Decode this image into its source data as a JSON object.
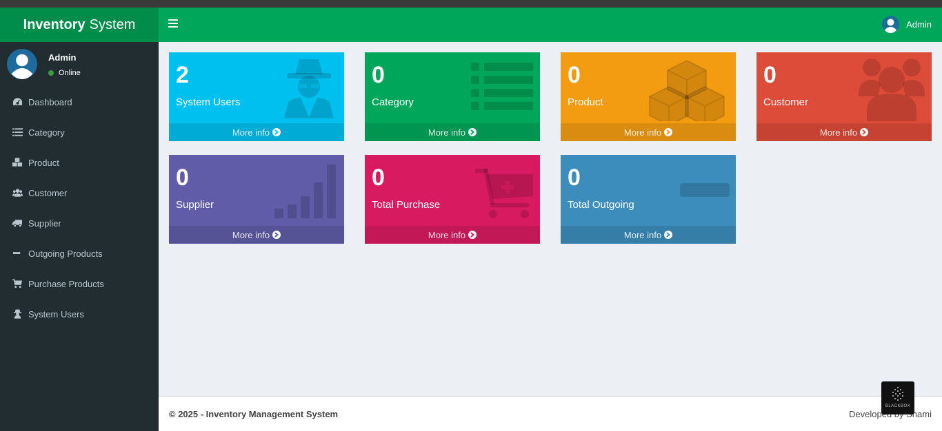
{
  "app": {
    "logo_bold": "Inventory",
    "logo_light": "System"
  },
  "header": {
    "user_name": "Admin"
  },
  "sidebar": {
    "user": {
      "name": "Admin",
      "status": "Online"
    },
    "items": [
      {
        "label": "Dashboard",
        "icon": "dashboard-icon"
      },
      {
        "label": "Category",
        "icon": "list-icon"
      },
      {
        "label": "Product",
        "icon": "cubes-icon"
      },
      {
        "label": "Customer",
        "icon": "users-icon"
      },
      {
        "label": "Supplier",
        "icon": "truck-icon"
      },
      {
        "label": "Outgoing Products",
        "icon": "minus-icon"
      },
      {
        "label": "Purchase Products",
        "icon": "cart-icon"
      },
      {
        "label": "System Users",
        "icon": "user-secret-icon"
      }
    ]
  },
  "boxes": [
    {
      "value": "2",
      "label": "System Users",
      "more": "More info",
      "color": "#00c0ef",
      "icon": "user-secret-icon"
    },
    {
      "value": "0",
      "label": "Category",
      "more": "More info",
      "color": "#00a65a",
      "icon": "list-icon"
    },
    {
      "value": "0",
      "label": "Product",
      "more": "More info",
      "color": "#f39c12",
      "icon": "cubes-icon"
    },
    {
      "value": "0",
      "label": "Customer",
      "more": "More info",
      "color": "#dd4b39",
      "icon": "users-icon"
    },
    {
      "value": "0",
      "label": "Supplier",
      "more": "More info",
      "color": "#605ca8",
      "icon": "signal-icon"
    },
    {
      "value": "0",
      "label": "Total Purchase",
      "more": "More info",
      "color": "#d81b60",
      "icon": "cart-plus-icon"
    },
    {
      "value": "0",
      "label": "Total Outgoing",
      "more": "More info",
      "color": "#3c8dbc",
      "icon": "minus-icon"
    }
  ],
  "footer": {
    "copyright": "© 2025 - Inventory Management System",
    "developer": "Developed by Shami"
  },
  "watermark": {
    "text": "BLACKBOX"
  }
}
